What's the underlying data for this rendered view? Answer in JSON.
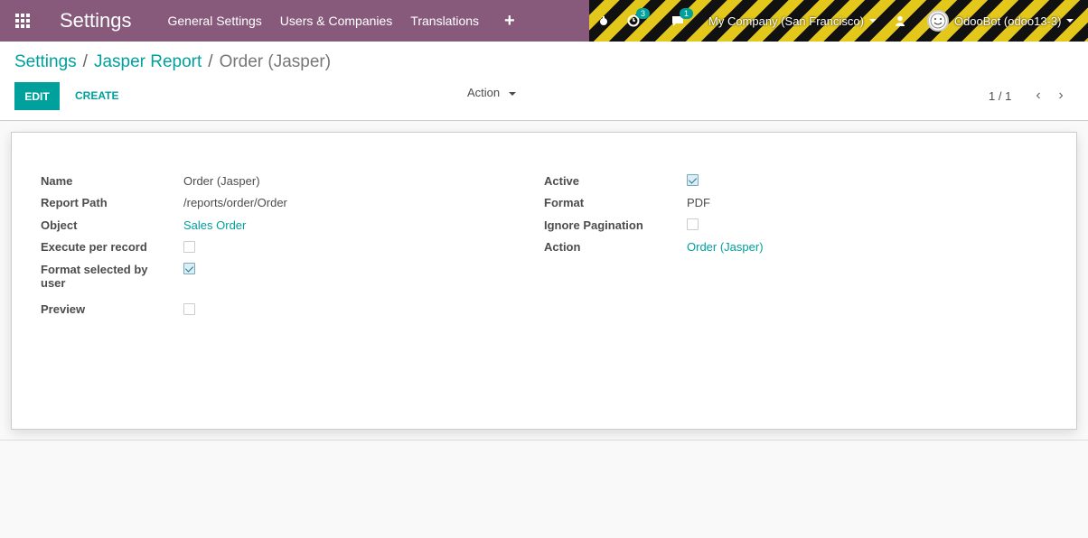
{
  "navbar": {
    "app_title": "Settings",
    "menu": [
      "General Settings",
      "Users & Companies",
      "Translations"
    ],
    "plus": "+",
    "activity_badge": "3",
    "messages_badge": "1",
    "company": "My Company (San Francisco)",
    "user": "OdooBot (odoo13-3)"
  },
  "breadcrumb": {
    "items": [
      "Settings",
      "Jasper Report"
    ],
    "current": "Order (Jasper)"
  },
  "buttons": {
    "edit": "EDIT",
    "create": "CREATE",
    "action": "Action"
  },
  "pager": {
    "value": "1 / 1"
  },
  "form": {
    "left": {
      "name_label": "Name",
      "name_value": "Order (Jasper)",
      "report_path_label": "Report Path",
      "report_path_value": "/reports/order/Order",
      "object_label": "Object",
      "object_value": "Sales Order",
      "execute_label": "Execute per record",
      "execute_checked": false,
      "format_selected_label_1": "Format selected by",
      "format_selected_label_2": "user",
      "format_selected_checked": true,
      "preview_label": "Preview",
      "preview_checked": false
    },
    "right": {
      "active_label": "Active",
      "active_checked": true,
      "format_label": "Format",
      "format_value": "PDF",
      "ignore_pagination_label": "Ignore Pagination",
      "ignore_pagination_checked": false,
      "action_label": "Action",
      "action_value": "Order (Jasper)"
    }
  },
  "colors": {
    "navbar": "#875a7b",
    "accent": "#00a09d"
  }
}
